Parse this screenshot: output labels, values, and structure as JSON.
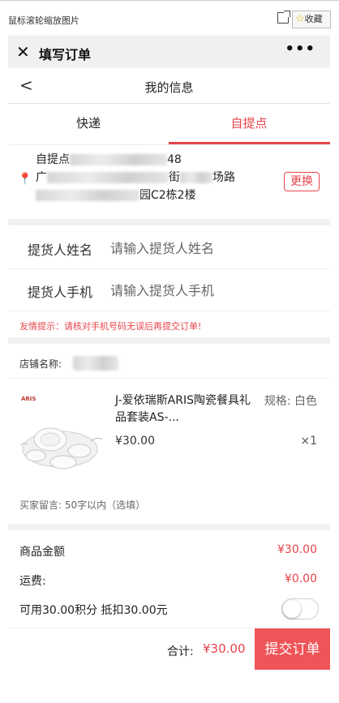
{
  "viewer": {
    "hint": "鼠标滚轮缩放图片",
    "favorite_label": "收藏"
  },
  "titlebar": {
    "title": "填写订单",
    "more": "•••"
  },
  "navbar": {
    "back": "<",
    "title": "我的信息"
  },
  "tabs": [
    {
      "label": "快递",
      "active": false
    },
    {
      "label": "自提点",
      "active": true
    }
  ],
  "address": {
    "line1_prefix": "自提点",
    "line1_suffix": "48",
    "line2_prefix": "广",
    "line2_mid": "街",
    "line2_suffix": "场路",
    "line3_suffix": "园C2栋2楼",
    "swap_label": "更换"
  },
  "pickup": {
    "name_label": "提货人姓名",
    "name_placeholder": "请输入提货人姓名",
    "phone_label": "提货人手机",
    "phone_placeholder": "请输入提货人手机"
  },
  "tip": "友情提示：请核对手机号码无误后再提交订单!",
  "store": {
    "label": "店铺名称:"
  },
  "product": {
    "logo_text": "ARIS",
    "name": "J-爱依瑞斯ARIS陶瓷餐具礼品套装AS-...",
    "spec": "规格: 白色",
    "price": "¥30.00",
    "qty": "×1"
  },
  "memo": {
    "label": "买家留言:",
    "placeholder": "50字以内（选填）"
  },
  "summary": {
    "goods_label": "商品金额",
    "goods_value": "¥30.00",
    "shipping_label": "运费:",
    "shipping_value": "¥0.00",
    "points_label": "可用30.00积分 抵扣30.00元",
    "points_enabled": false
  },
  "footer": {
    "total_label": "合计:",
    "total_value": "¥30.00",
    "submit_label": "提交订单"
  },
  "colors": {
    "accent": "#e6444b",
    "submit_bg": "#ef5458",
    "titlebar_bg": "#f0f0f0"
  }
}
